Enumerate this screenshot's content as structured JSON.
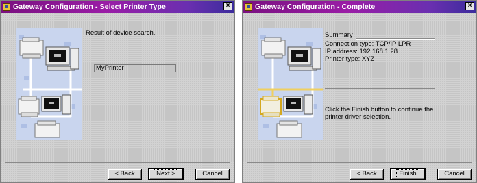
{
  "window1": {
    "title": "Gateway Configuration - Select Printer Type",
    "close_label": "×",
    "result_label": "Result of device search.",
    "printer_field_value": "MyPrinter",
    "buttons": {
      "back": "< Back",
      "next": "Next >",
      "cancel": "Cancel"
    }
  },
  "window2": {
    "title": "Gateway Configuration - Complete",
    "close_label": "×",
    "summary_label": "Summary",
    "summary_lines": [
      "Connection type: TCP/IP LPR",
      "IP address: 192.168.1.28",
      "Printer type: XYZ"
    ],
    "finish_text_lines": [
      "Click the Finish button to continue the",
      "printer driver selection."
    ],
    "buttons": {
      "back": "< Back",
      "finish": "Finish",
      "cancel": "Cancel"
    }
  },
  "colors": {
    "titlebar_start": "#7a1080",
    "titlebar_end": "#3b2c9c",
    "network_line": "#ffffff",
    "highlight_line": "#f0d060"
  }
}
